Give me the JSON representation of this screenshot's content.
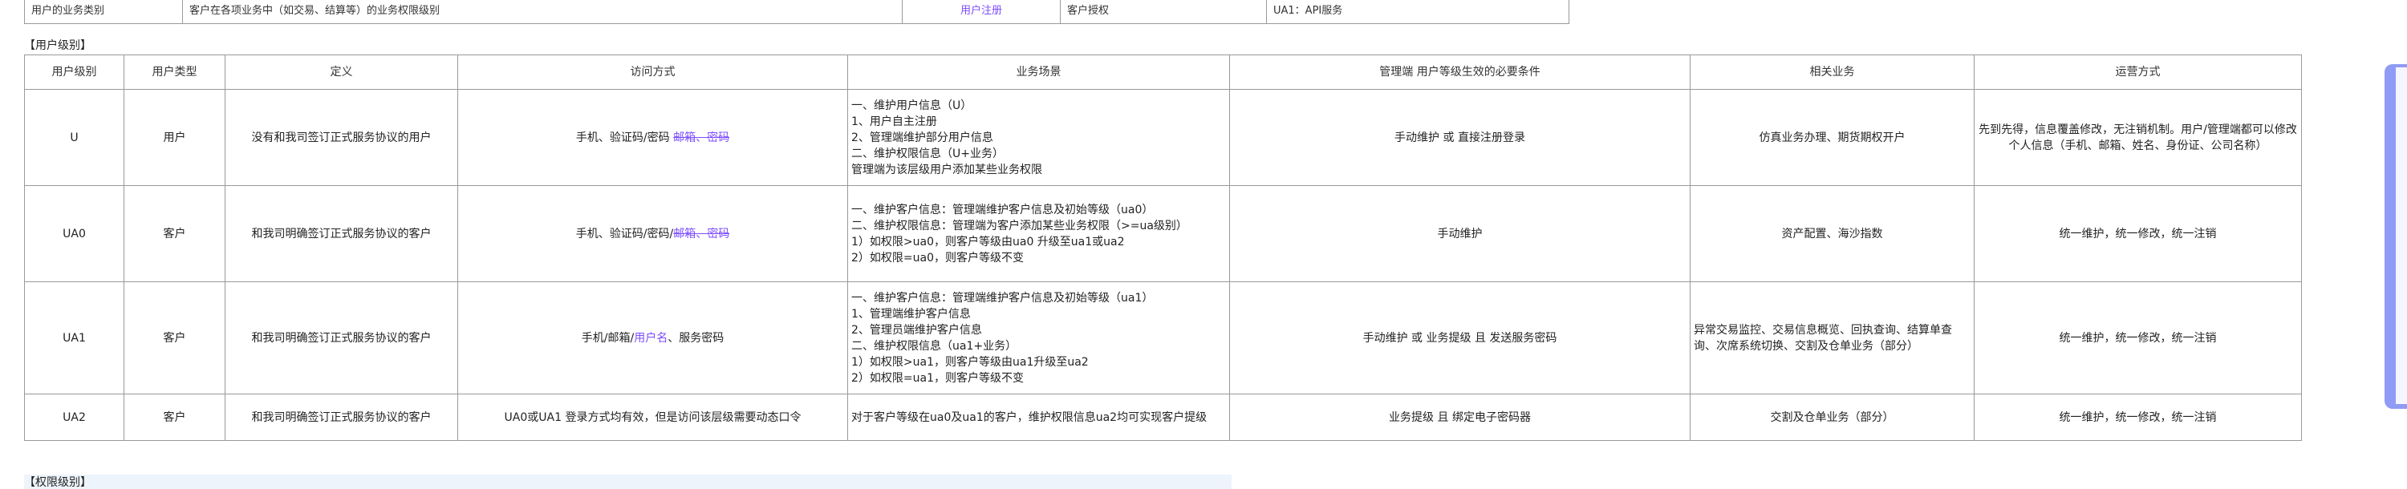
{
  "top_row": {
    "col1": "用户的业务类别",
    "col2": "客户在各项业务中（如交易、结算等）的业务权限级别",
    "col3": "用户注册",
    "col4": "客户授权",
    "col5": "UA1：API服务"
  },
  "user_level_section": {
    "label": "【用户级别】",
    "headers": [
      "用户级别",
      "用户类型",
      "定义",
      "访问方式",
      "业务场景",
      "管理端 用户等级生效的必要条件",
      "相关业务",
      "运营方式"
    ],
    "rows": [
      {
        "level": "U",
        "type": "用户",
        "definition": "没有和我司签订正式服务协议的用户",
        "access_main": "手机、验证码/密码 ",
        "access_strike": "邮箱、密码",
        "scenario": [
          "一、维护用户信息（U）",
          "1、用户自主注册",
          "2、管理端维护部分用户信息",
          "二、维护权限信息（U+业务）",
          "管理端为该层级用户添加某些业务权限"
        ],
        "condition": "手动维护 或 直接注册登录",
        "related": "仿真业务办理、期货期权开户",
        "operation": "先到先得，信息覆盖修改，无注销机制。用户/管理端都可以修改个人信息（手机、邮箱、姓名、身份证、公司名称）"
      },
      {
        "level": "UA0",
        "type": "客户",
        "definition": "和我司明确签订正式服务协议的客户",
        "access_main": "手机、验证码/密码/",
        "access_strike": "邮箱、密码",
        "scenario": [
          "一、维护客户信息：管理端维护客户信息及初始等级（ua0）",
          "二、维护权限信息：管理端为客户添加某些业务权限（>=ua级别）",
          "1）如权限>ua0，则客户等级由ua0 升级至ua1或ua2",
          "2）如权限=ua0，则客户等级不变"
        ],
        "condition": "手动维护",
        "related": "资产配置、海沙指数",
        "operation": "统一维护，统一修改，统一注销"
      },
      {
        "level": "UA1",
        "type": "客户",
        "definition": "和我司明确签订正式服务协议的客户",
        "access_main": "手机/邮箱/",
        "access_purple": "用户名",
        "access_tail": "、服务密码",
        "scenario": [
          "一、维护客户信息：管理端维护客户信息及初始等级（ua1）",
          "1、管理端维护客户信息",
          "2、管理员端维护客户信息",
          "二、维护权限信息（ua1+业务）",
          "1）如权限>ua1，则客户等级由ua1升级至ua2",
          "2）如权限=ua1，则客户等级不变"
        ],
        "condition": "手动维护 或 业务提级 且 发送服务密码",
        "related": "异常交易监控、交易信息概览、回执查询、结算单查询、次席系统切换、交割及仓单业务（部分）",
        "operation": "统一维护，统一修改，统一注销"
      },
      {
        "level": "UA2",
        "type": "客户",
        "definition": "和我司明确签订正式服务协议的客户",
        "access_main": "UA0或UA1 登录方式均有效，但是访问该层级需要动态口令",
        "scenario": [
          "对于客户等级在ua0及ua1的客户，维护权限信息ua2均可实现客户提级"
        ],
        "condition": "业务提级 且 绑定电子密码器",
        "related": "交割及仓单业务（部分）",
        "operation": "统一维护，统一修改，统一注销"
      }
    ]
  },
  "permission_section": {
    "label": "【权限级别】"
  },
  "colors": {
    "border": "#999999",
    "link_purple": "#7c4dff",
    "side_panel": "#8f9bf5",
    "bottom_band": "#eef4fb"
  }
}
